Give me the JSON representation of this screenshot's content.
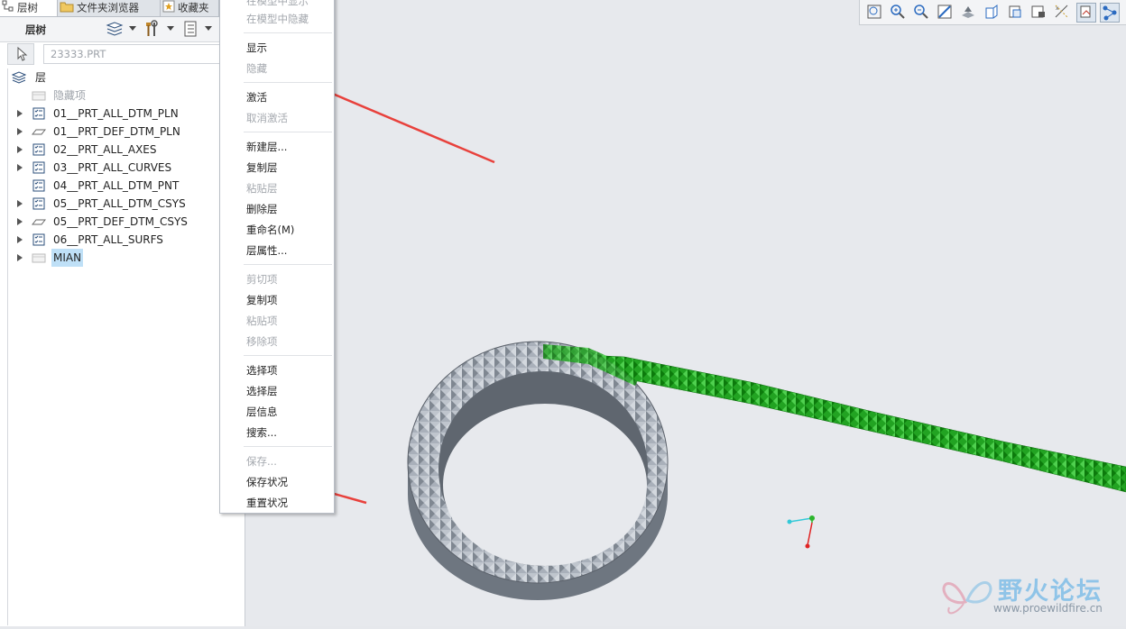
{
  "tabs": [
    {
      "label": "层树"
    },
    {
      "label": "文件夹浏览器"
    },
    {
      "label": "收藏夹"
    }
  ],
  "toolbar": {
    "title": "层树"
  },
  "model_field": {
    "value": "23333.PRT"
  },
  "tree": {
    "root_label": "层",
    "items": [
      {
        "label": "隐藏项"
      },
      {
        "label": "01__PRT_ALL_DTM_PLN"
      },
      {
        "label": "01__PRT_DEF_DTM_PLN"
      },
      {
        "label": "02__PRT_ALL_AXES"
      },
      {
        "label": "03__PRT_ALL_CURVES"
      },
      {
        "label": "04__PRT_ALL_DTM_PNT"
      },
      {
        "label": "05__PRT_ALL_DTM_CSYS"
      },
      {
        "label": "05__PRT_DEF_DTM_CSYS"
      },
      {
        "label": "06__PRT_ALL_SURFS"
      },
      {
        "label": "MIAN"
      }
    ]
  },
  "context_menu": {
    "items": [
      {
        "label": "在模型中显示"
      },
      {
        "label": "在模型中隐藏"
      },
      {
        "label": "显示"
      },
      {
        "label": "隐藏"
      },
      {
        "label": "激活"
      },
      {
        "label": "取消激活"
      },
      {
        "label": "新建层..."
      },
      {
        "label": "复制层"
      },
      {
        "label": "粘贴层"
      },
      {
        "label": "删除层"
      },
      {
        "label": "重命名(M)"
      },
      {
        "label": "层属性..."
      },
      {
        "label": "剪切项"
      },
      {
        "label": "复制项"
      },
      {
        "label": "粘贴项"
      },
      {
        "label": "移除项"
      },
      {
        "label": "选择项"
      },
      {
        "label": "选择层"
      },
      {
        "label": "层信息"
      },
      {
        "label": "搜索..."
      },
      {
        "label": "保存..."
      },
      {
        "label": "保存状况"
      },
      {
        "label": "重置状况"
      }
    ]
  },
  "watermark": {
    "title": "野火论坛",
    "url": "www.proewildfire.cn"
  },
  "colors": {
    "annotation_arrow": "#e8413c",
    "model_gray": "#8a929c",
    "highlight_green": "#1a9e1a"
  }
}
